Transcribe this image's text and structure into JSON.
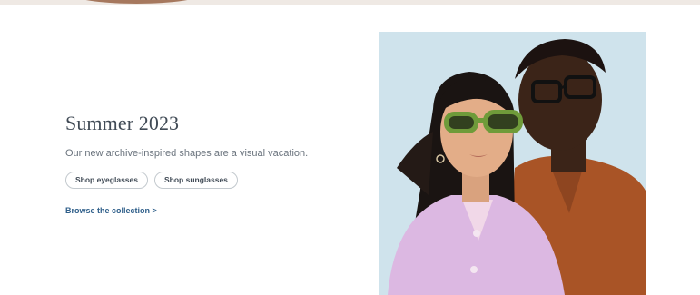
{
  "hero": {
    "title": "Summer 2023",
    "subtitle": "Our new archive-inspired shapes are a visual vacation.",
    "buttons": {
      "eyeglasses": "Shop eyeglasses",
      "sunglasses": "Shop sunglasses"
    },
    "browse_link": "Browse the collection >"
  },
  "image": {
    "subject": "two models wearing glasses"
  },
  "colors": {
    "title_text": "#414b56",
    "body_text": "#6a737d",
    "link": "#2f5f8a",
    "pill_border": "#c3c9ce",
    "photo_background": "#cfe3ec",
    "top_strip": "#efe9e4"
  }
}
